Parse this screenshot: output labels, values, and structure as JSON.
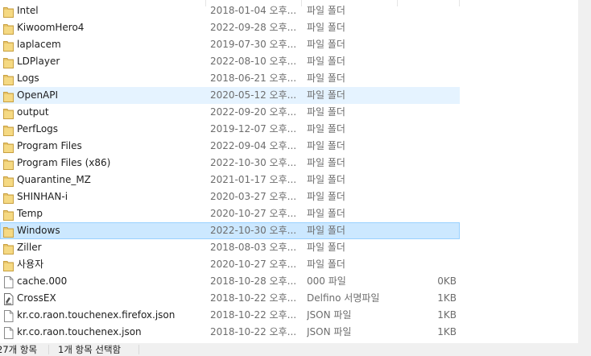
{
  "files": [
    {
      "name": "Intel",
      "date": "2018-01-04 오후...",
      "type": "파일 폴더",
      "size": "",
      "icon": "folder-icon"
    },
    {
      "name": "KiwoomHero4",
      "date": "2022-09-28 오후...",
      "type": "파일 폴더",
      "size": "",
      "icon": "folder-icon"
    },
    {
      "name": "laplacem",
      "date": "2019-07-30 오후...",
      "type": "파일 폴더",
      "size": "",
      "icon": "folder-icon"
    },
    {
      "name": "LDPlayer",
      "date": "2022-08-10 오후...",
      "type": "파일 폴더",
      "size": "",
      "icon": "folder-icon"
    },
    {
      "name": "Logs",
      "date": "2018-06-21 오후...",
      "type": "파일 폴더",
      "size": "",
      "icon": "folder-icon"
    },
    {
      "name": "OpenAPI",
      "date": "2020-05-12 오후...",
      "type": "파일 폴더",
      "size": "",
      "icon": "folder-icon"
    },
    {
      "name": "output",
      "date": "2022-09-20 오후...",
      "type": "파일 폴더",
      "size": "",
      "icon": "folder-icon"
    },
    {
      "name": "PerfLogs",
      "date": "2019-12-07 오후...",
      "type": "파일 폴더",
      "size": "",
      "icon": "folder-icon"
    },
    {
      "name": "Program Files",
      "date": "2022-09-04 오후...",
      "type": "파일 폴더",
      "size": "",
      "icon": "folder-icon"
    },
    {
      "name": "Program Files (x86)",
      "date": "2022-10-30 오후...",
      "type": "파일 폴더",
      "size": "",
      "icon": "folder-icon"
    },
    {
      "name": "Quarantine_MZ",
      "date": "2021-01-17 오후...",
      "type": "파일 폴더",
      "size": "",
      "icon": "folder-icon"
    },
    {
      "name": "SHINHAN-i",
      "date": "2020-03-27 오후...",
      "type": "파일 폴더",
      "size": "",
      "icon": "folder-icon"
    },
    {
      "name": "Temp",
      "date": "2020-10-27 오후...",
      "type": "파일 폴더",
      "size": "",
      "icon": "folder-icon"
    },
    {
      "name": "Windows",
      "date": "2022-10-30 오후...",
      "type": "파일 폴더",
      "size": "",
      "icon": "folder-icon"
    },
    {
      "name": "Ziller",
      "date": "2018-08-03 오후...",
      "type": "파일 폴더",
      "size": "",
      "icon": "folder-icon"
    },
    {
      "name": "사용자",
      "date": "2020-10-27 오후...",
      "type": "파일 폴더",
      "size": "",
      "icon": "folder-icon"
    },
    {
      "name": "cache.000",
      "date": "2018-10-28 오후...",
      "type": "000 파일",
      "size": "0KB",
      "icon": "file-icon"
    },
    {
      "name": "CrossEX",
      "date": "2018-10-22 오후...",
      "type": "Delfino 서명파일",
      "size": "1KB",
      "icon": "signed-file-icon"
    },
    {
      "name": "kr.co.raon.touchenex.firefox.json",
      "date": "2018-10-22 오후...",
      "type": "JSON 파일",
      "size": "1KB",
      "icon": "file-icon"
    },
    {
      "name": "kr.co.raon.touchenex.json",
      "date": "2018-10-22 오후...",
      "type": "JSON 파일",
      "size": "1KB",
      "icon": "file-icon"
    }
  ],
  "hovered_row": "OpenAPI",
  "selected_row": "Windows",
  "status": {
    "item_count": "27개 항목",
    "selected_count": "1개 항목 선택함"
  },
  "colors": {
    "hover": "#e5f3ff",
    "selected": "#cce8ff",
    "selected_border": "#99d1ff",
    "folder": "#e8c46a"
  }
}
